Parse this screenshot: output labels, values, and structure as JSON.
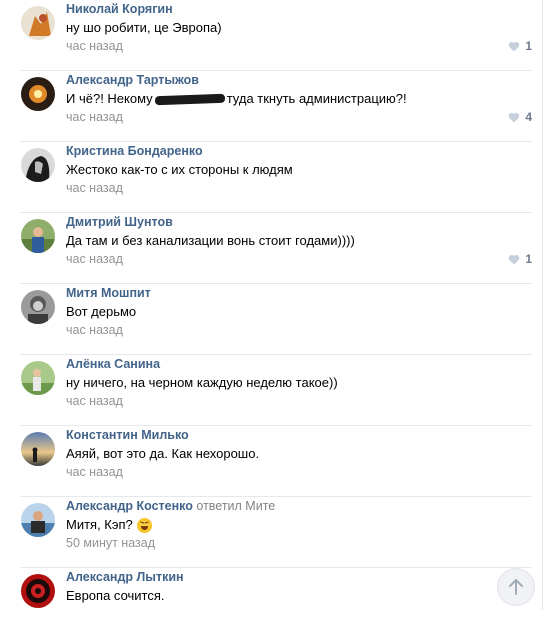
{
  "comments": [
    {
      "author": "Николай Корягин",
      "text": "ну шо робити, це Эвропа)",
      "time": "час назад",
      "likes": "1"
    },
    {
      "author": "Александр Тартыжов",
      "text_before": "И чё?! Некому",
      "text_after": "туда ткнуть администрацию?!",
      "time": "час назад",
      "likes": "4"
    },
    {
      "author": "Кристина Бондаренко",
      "text": "Жестоко как-то с их стороны к людям",
      "time": "час назад"
    },
    {
      "author": "Дмитрий Шунтов",
      "text": "Да там и без канализации вонь стоит годами))))",
      "time": "час назад",
      "likes": "1"
    },
    {
      "author": "Митя Мошпит",
      "text": "Вот дерьмо",
      "time": "час назад"
    },
    {
      "author": "Алёнка Санина",
      "text": "ну ничего, на черном каждую неделю такое))",
      "time": "час назад"
    },
    {
      "author": "Константин Милько",
      "text": "Аяяй, вот это да. Как нехорошо.",
      "time": "час назад"
    },
    {
      "author": "Александр Костенко",
      "reply_note": "ответил Мите",
      "text": "Митя, Кэп?",
      "time": "50 минут назад"
    },
    {
      "author": "Александр Лыткин",
      "text": "Европа сочится."
    }
  ],
  "colors": {
    "author": "#42648b",
    "meta": "#939393",
    "like": "#6d7a8c"
  }
}
